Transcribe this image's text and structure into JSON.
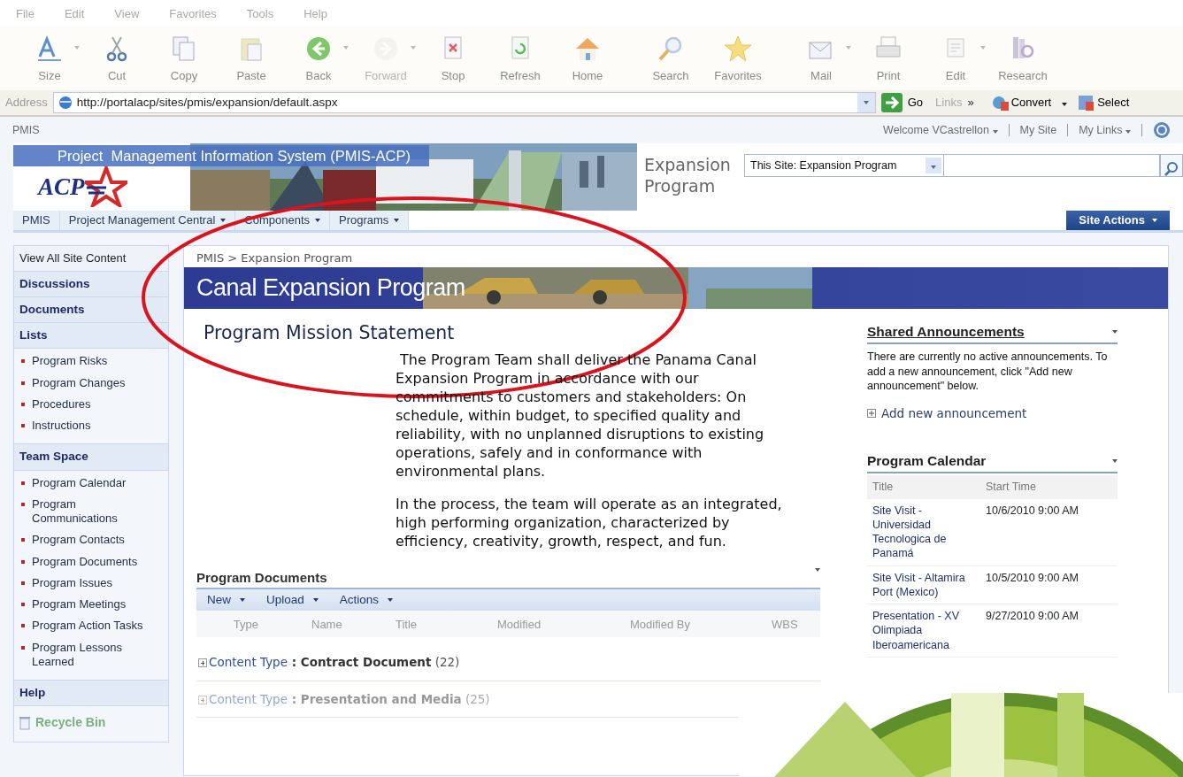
{
  "menu_bar": [
    "File",
    "Edit",
    "View",
    "Favorites",
    "Tools",
    "Help"
  ],
  "toolbar": [
    {
      "label": "Size",
      "disabled": false,
      "dropdown": true
    },
    {
      "label": "Cut",
      "disabled": false,
      "dropdown": false
    },
    {
      "label": "Copy",
      "disabled": false,
      "dropdown": false
    },
    {
      "label": "Paste",
      "disabled": false,
      "dropdown": false
    },
    {
      "label": "Back",
      "disabled": false,
      "dropdown": true
    },
    {
      "label": "Forward",
      "disabled": true,
      "dropdown": true
    },
    {
      "label": "Stop",
      "disabled": false,
      "dropdown": false
    },
    {
      "label": "Refresh",
      "disabled": false,
      "dropdown": false
    },
    {
      "label": "Home",
      "disabled": false,
      "dropdown": false
    },
    {
      "label": "Search",
      "disabled": false,
      "dropdown": false
    },
    {
      "label": "Favorites",
      "disabled": false,
      "dropdown": false
    },
    {
      "label": "Mail",
      "disabled": false,
      "dropdown": true
    },
    {
      "label": "Print",
      "disabled": false,
      "dropdown": false
    },
    {
      "label": "Edit",
      "disabled": false,
      "dropdown": true
    },
    {
      "label": "Research",
      "disabled": false,
      "dropdown": false
    }
  ],
  "address_bar": {
    "label": "Address",
    "url": "http://portalacp/sites/pmis/expansion/default.aspx",
    "go": "Go",
    "links": "Links",
    "chevron": "»",
    "convert": "Convert",
    "select": "Select"
  },
  "top_bar": {
    "site": "PMIS",
    "links": [
      {
        "label": "Welcome VCastrellon",
        "dropdown": true
      },
      {
        "label": "My Site",
        "dropdown": false
      },
      {
        "label": "My Links",
        "dropdown": true
      }
    ]
  },
  "header": {
    "banner_title": "Project  Management Information System (PMIS-ACP)",
    "logo_text": "ACP",
    "site_title": "Expansion Program",
    "search_scope": "This Site: Expansion Program"
  },
  "nav_tabs": [
    {
      "label": "PMIS",
      "dropdown": false
    },
    {
      "label": "Project Management Central",
      "dropdown": true
    },
    {
      "label": "Components",
      "dropdown": true
    },
    {
      "label": "Programs",
      "dropdown": true
    }
  ],
  "site_actions": "Site Actions",
  "sidebar": {
    "view_all": "View All Site Content",
    "sections": [
      {
        "heading": "Discussions"
      },
      {
        "heading": "Documents"
      },
      {
        "heading": "Lists",
        "items": [
          "Program Risks",
          "Program Changes",
          "Procedures",
          "Instructions"
        ]
      },
      {
        "heading": "Team Space",
        "items": [
          "Program Calendar",
          "Program Communications",
          "Program Contacts",
          "Program Documents",
          "Program Issues",
          "Program Meetings",
          "Program Action Tasks",
          "Program Lessons Learned"
        ]
      },
      {
        "heading": "Help"
      }
    ],
    "recycle_bin": "Recycle Bin"
  },
  "breadcrumb": "PMIS > Expansion Program",
  "page_title": "Canal Expansion Program",
  "mission": {
    "title": "Program Mission Statement",
    "paragraphs": [
      " The Program Team shall deliver the Panama Canal Expansion Program in accordance with our commitments to customers and stakeholders: On schedule, within budget, to specified quality and reliability, with no unplanned disruptions to existing operations, safely and in conformance with environmental plans.",
      "In the process, the team will operate as an integrated, high performing organization, characterized by efficiency, creativity, growth, respect, and fun."
    ]
  },
  "documents": {
    "title": "Program Documents",
    "actions": [
      "New",
      "Upload",
      "Actions"
    ],
    "columns": [
      "Type",
      "Name",
      "Title",
      "Modified",
      "Modified By",
      "WBS"
    ],
    "groups": [
      {
        "label": "Content Type",
        "separator": ":",
        "name": "Contract Document",
        "count": "(22)",
        "dimmed": false
      },
      {
        "label": "Content Type",
        "separator": ":",
        "name": "Presentation and Media",
        "count": "(25)",
        "dimmed": true
      }
    ]
  },
  "announcements": {
    "title": "Shared Announcements",
    "text": "There are currently no active announcements. To add a new announcement, click \"Add new announcement\" below.",
    "add_link": "Add new announcement"
  },
  "calendar": {
    "title": "Program Calendar",
    "columns": [
      "Title",
      "Start Time"
    ],
    "rows": [
      {
        "title": "Site Visit - Universidad Tecnologica de Panamá",
        "start": "10/6/2010 9:00 AM"
      },
      {
        "title": "Site Visit - Altamira Port (Mexico)",
        "start": "10/5/2010 9:00 AM"
      },
      {
        "title": "Presentation - XV Olimpiada Iberoamericana",
        "start": "9/27/2010 9:00 AM"
      }
    ]
  }
}
